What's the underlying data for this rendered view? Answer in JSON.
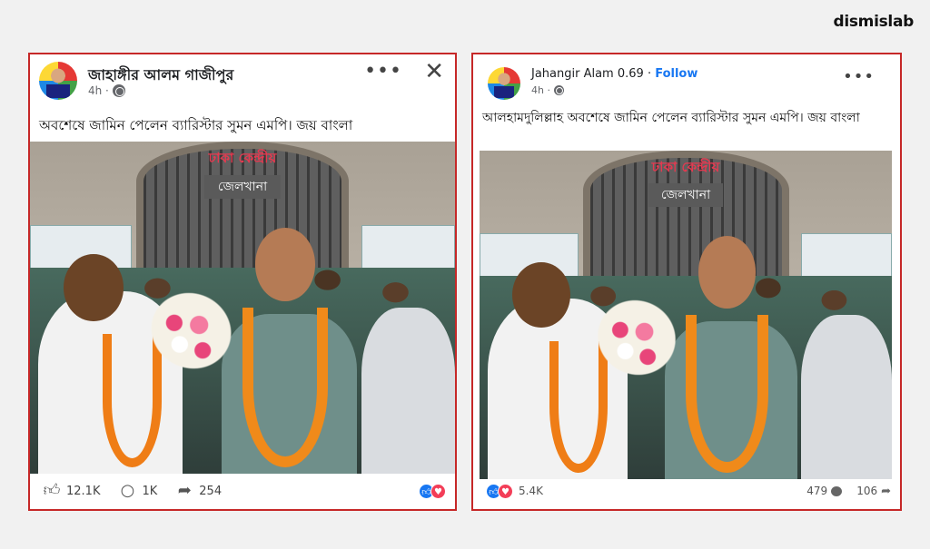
{
  "brand": {
    "logo_text": "dismislab"
  },
  "left_post": {
    "author": "জাহাঙ্গীর আলম গাজীপুর",
    "time": "4h ·",
    "caption": "অবশেষে জামিন পেলেন ব্যারিস্টার সুমন এমপি। জয় বাংলা",
    "photo": {
      "sign_top": "ঢাকা কেন্দ্রীয়",
      "sign_bottom": "জেলখানা"
    },
    "menu_icon": "more-horizontal-icon",
    "close_icon": "close-icon",
    "likes": "12.1K",
    "comments": "1K",
    "shares": "254"
  },
  "right_post": {
    "author": "Jahangir Alam 0.69",
    "follow_label": "Follow",
    "time": "4h ·",
    "caption": "আলহামদুলিল্লাহ অবশেষে জামিন পেলেন ব্যারিস্টার সুমন এমপি। জয় বাংলা",
    "photo": {
      "sign_top": "ঢাকা কেন্দ্রীয়",
      "sign_bottom": "জেলখানা"
    },
    "menu_icon": "more-horizontal-icon",
    "reactions": "5.4K",
    "comments": "479",
    "shares": "106"
  },
  "colors": {
    "frame_border": "#c62828",
    "facebook_blue": "#1877f2",
    "love_red": "#f33e58"
  }
}
